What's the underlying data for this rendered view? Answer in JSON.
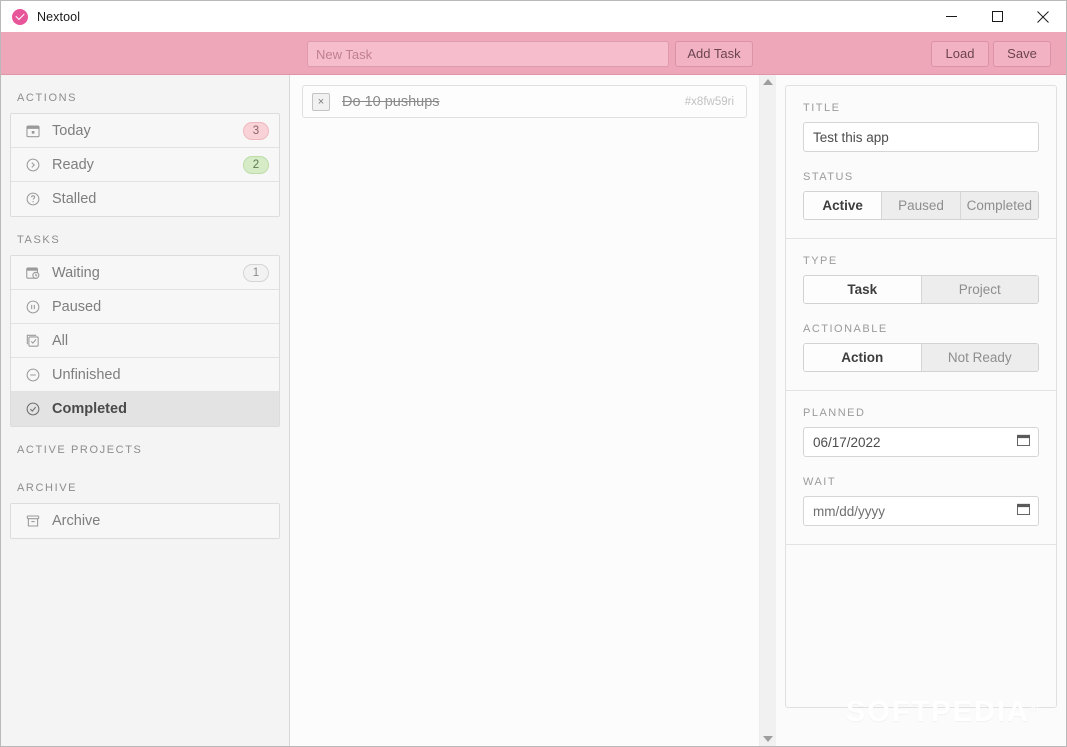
{
  "window": {
    "title": "Nextool",
    "app_icon": "check-circle-icon",
    "controls": {
      "minimize": "minimize-icon",
      "maximize": "maximize-icon",
      "close": "close-icon"
    }
  },
  "toolbar": {
    "new_task_placeholder": "New Task",
    "new_task_value": "",
    "add_task_label": "Add Task",
    "load_label": "Load",
    "save_label": "Save",
    "background_color": "#eda7b8"
  },
  "sidebar": {
    "groups": [
      {
        "label": "ACTIONS",
        "items": [
          {
            "label": "Today",
            "icon": "calendar-icon",
            "badge": "3",
            "badge_color": "pink",
            "active": false
          },
          {
            "label": "Ready",
            "icon": "circle-chevron-right-icon",
            "badge": "2",
            "badge_color": "green",
            "active": false
          },
          {
            "label": "Stalled",
            "icon": "question-circle-icon",
            "badge": "",
            "badge_color": "",
            "active": false
          }
        ]
      },
      {
        "label": "TASKS",
        "items": [
          {
            "label": "Waiting",
            "icon": "calendar-clock-icon",
            "badge": "1",
            "badge_color": "gray",
            "active": false
          },
          {
            "label": "Paused",
            "icon": "pause-circle-icon",
            "badge": "",
            "badge_color": "",
            "active": false
          },
          {
            "label": "All",
            "icon": "clipboard-check-icon",
            "badge": "",
            "badge_color": "",
            "active": false
          },
          {
            "label": "Unfinished",
            "icon": "minus-circle-icon",
            "badge": "",
            "badge_color": "",
            "active": false
          },
          {
            "label": "Completed",
            "icon": "check-circle-icon",
            "badge": "",
            "badge_color": "",
            "active": true
          }
        ]
      },
      {
        "label": "ACTIVE PROJECTS",
        "items": []
      },
      {
        "label": "ARCHIVE",
        "items": [
          {
            "label": "Archive",
            "icon": "archive-icon",
            "badge": "",
            "badge_color": "",
            "active": false
          }
        ]
      }
    ]
  },
  "tasklist": {
    "items": [
      {
        "title": "Do 10 pushups",
        "id": "#x8fw59ri",
        "completed": true,
        "check_glyph": "×"
      }
    ],
    "scrollbar": {
      "up": "scroll-up-arrow",
      "down": "scroll-down-arrow"
    }
  },
  "detail": {
    "title_label": "TITLE",
    "title_value": "Test this app",
    "status_label": "STATUS",
    "status_options": [
      "Active",
      "Paused",
      "Completed"
    ],
    "status_selected": "Active",
    "type_label": "TYPE",
    "type_options": [
      "Task",
      "Project"
    ],
    "type_selected": "Task",
    "actionable_label": "ACTIONABLE",
    "actionable_options": [
      "Action",
      "Not Ready"
    ],
    "actionable_selected": "Action",
    "planned_label": "PLANNED",
    "planned_value": "06/17/2022",
    "wait_label": "WAIT",
    "wait_value": "",
    "wait_placeholder": "mm/dd/yyyy"
  },
  "watermark": {
    "text": "SOFTPEDIA",
    "mark": "®"
  }
}
